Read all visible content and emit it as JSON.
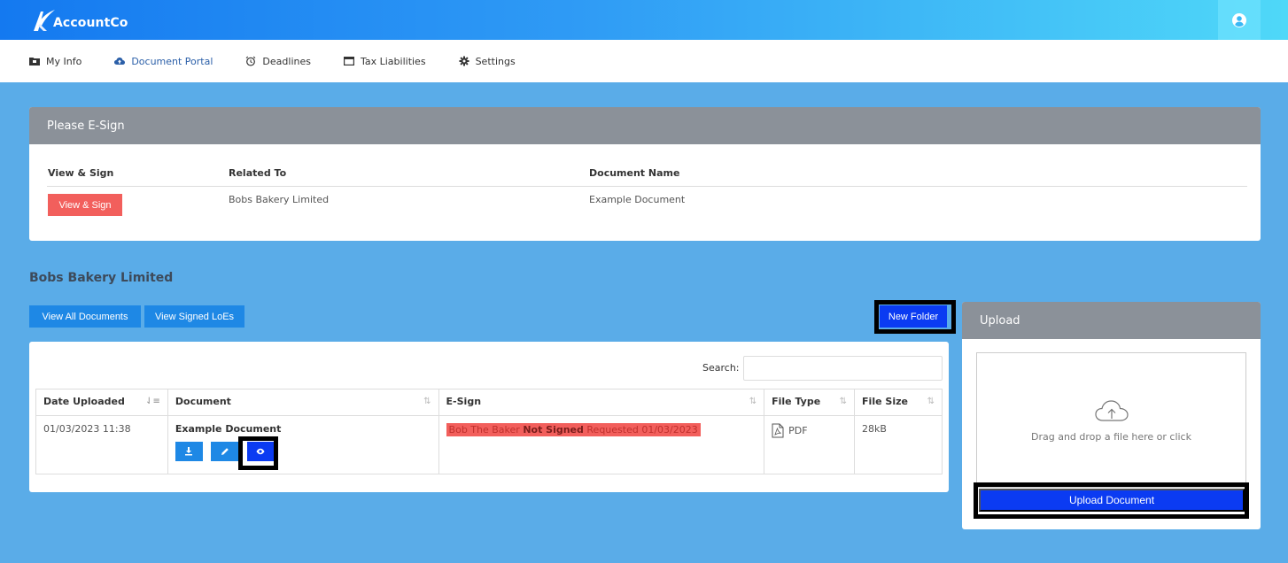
{
  "brand": {
    "name": "AccountCo"
  },
  "nav": {
    "items": [
      {
        "label": "My Info",
        "icon": "folder-icon"
      },
      {
        "label": "Document Portal",
        "icon": "cloud-upload-icon",
        "active": true
      },
      {
        "label": "Deadlines",
        "icon": "alarm-clock-icon"
      },
      {
        "label": "Tax Liabilities",
        "icon": "window-icon"
      },
      {
        "label": "Settings",
        "icon": "gear-icon"
      }
    ]
  },
  "esign": {
    "title": "Please E-Sign",
    "headers": [
      "View & Sign",
      "Related To",
      "Document Name"
    ],
    "rows": [
      {
        "button": "View & Sign",
        "related_to": "Bobs Bakery Limited",
        "document_name": "Example Document"
      }
    ]
  },
  "company": {
    "title": "Bobs Bakery Limited",
    "view_all_button": "View All Documents",
    "view_signed_button": "View Signed LoEs",
    "new_folder_button": "New Folder"
  },
  "documents": {
    "search_label": "Search:",
    "search_value": "",
    "columns": [
      "Date Uploaded",
      "Document",
      "E-Sign",
      "File Type",
      "File Size"
    ],
    "rows": [
      {
        "date": "01/03/2023 11:38",
        "document": "Example Document",
        "esign_name": "Bob The Baker",
        "esign_status": "Not Signed",
        "esign_requested": "Requested 01/03/2023",
        "file_type": "PDF",
        "file_size": "28kB"
      }
    ]
  },
  "upload": {
    "title": "Upload",
    "drop_text": "Drag and drop a file here or click",
    "button": "Upload Document"
  },
  "colors": {
    "background": "#5aace8",
    "primary": "#1e88e5",
    "highlight_button": "#0b3bf2",
    "danger": "#f25f5c",
    "card_header": "#8b9199"
  }
}
